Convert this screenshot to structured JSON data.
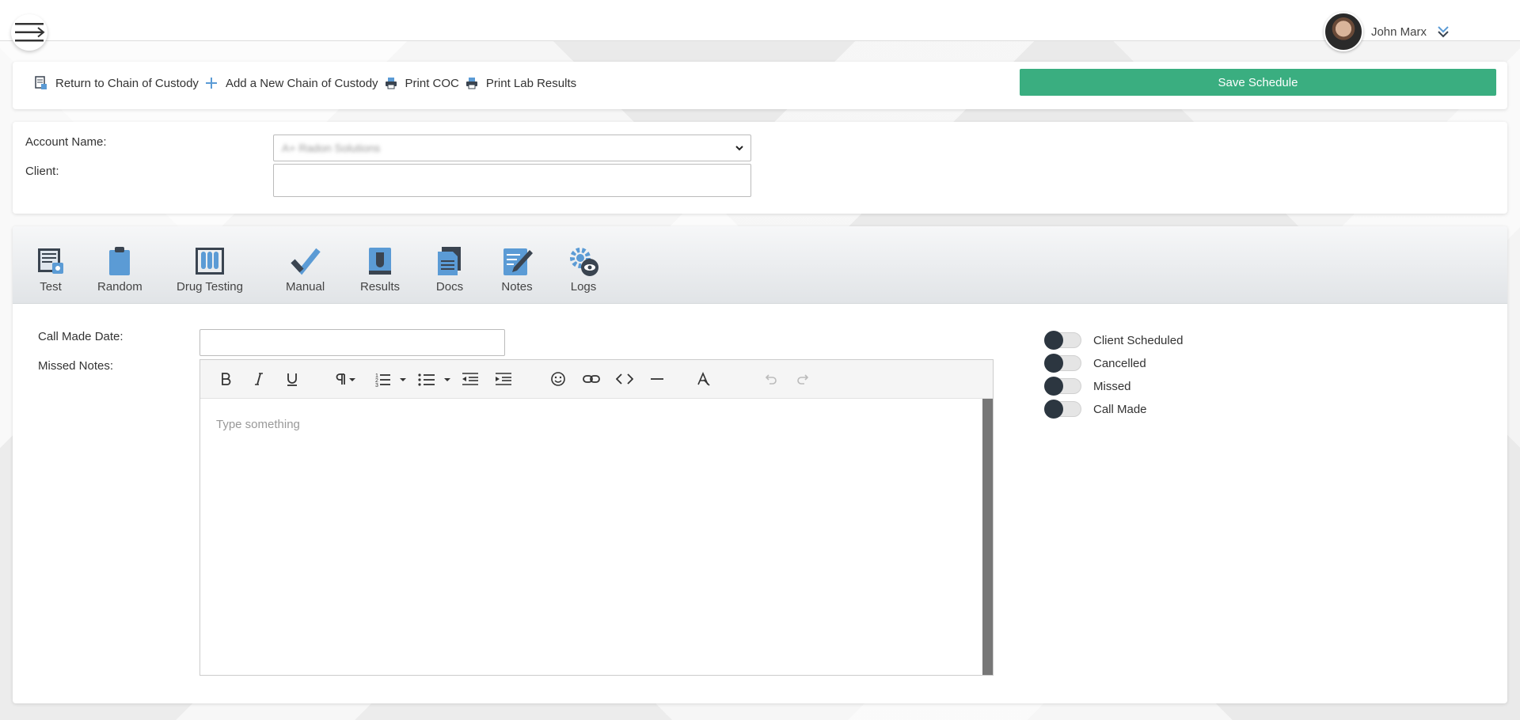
{
  "header": {
    "user_name": "John Marx",
    "menu_icon": "hamburger-menu-icon",
    "dropdown_icon": "chevron-double-down-icon"
  },
  "actions": {
    "return_label": "Return to Chain of Custody",
    "add_label": "Add a New Chain of Custody",
    "print_coc_label": "Print COC",
    "print_lab_label": "Print Lab Results",
    "save_label": "Save Schedule",
    "save_color": "#3aae80"
  },
  "account": {
    "account_name_label": "Account Name:",
    "account_name_value": "A+ Radon Solutions",
    "client_label": "Client:",
    "client_value": ""
  },
  "tabs": [
    {
      "label": "Test",
      "icon": "test-form-icon"
    },
    {
      "label": "Random",
      "icon": "clipboard-icon"
    },
    {
      "label": "Drug Testing",
      "icon": "test-tubes-icon"
    },
    {
      "label": "Manual",
      "icon": "checkmark-icon"
    },
    {
      "label": "Results",
      "icon": "results-book-icon"
    },
    {
      "label": "Docs",
      "icon": "documents-icon"
    },
    {
      "label": "Notes",
      "icon": "notes-pencil-icon"
    },
    {
      "label": "Logs",
      "icon": "logs-gear-eye-icon"
    }
  ],
  "form": {
    "call_made_date_label": "Call Made Date:",
    "call_made_date_value": "",
    "missed_notes_label": "Missed Notes:",
    "editor_placeholder": "Type something"
  },
  "toggles": [
    {
      "label": "Client Scheduled",
      "on": false
    },
    {
      "label": "Cancelled",
      "on": false
    },
    {
      "label": "Missed",
      "on": false
    },
    {
      "label": "Call Made",
      "on": false
    }
  ],
  "colors": {
    "accent": "#3aae80",
    "icon_blue": "#5b9bd5",
    "icon_dark": "#3a4450"
  }
}
